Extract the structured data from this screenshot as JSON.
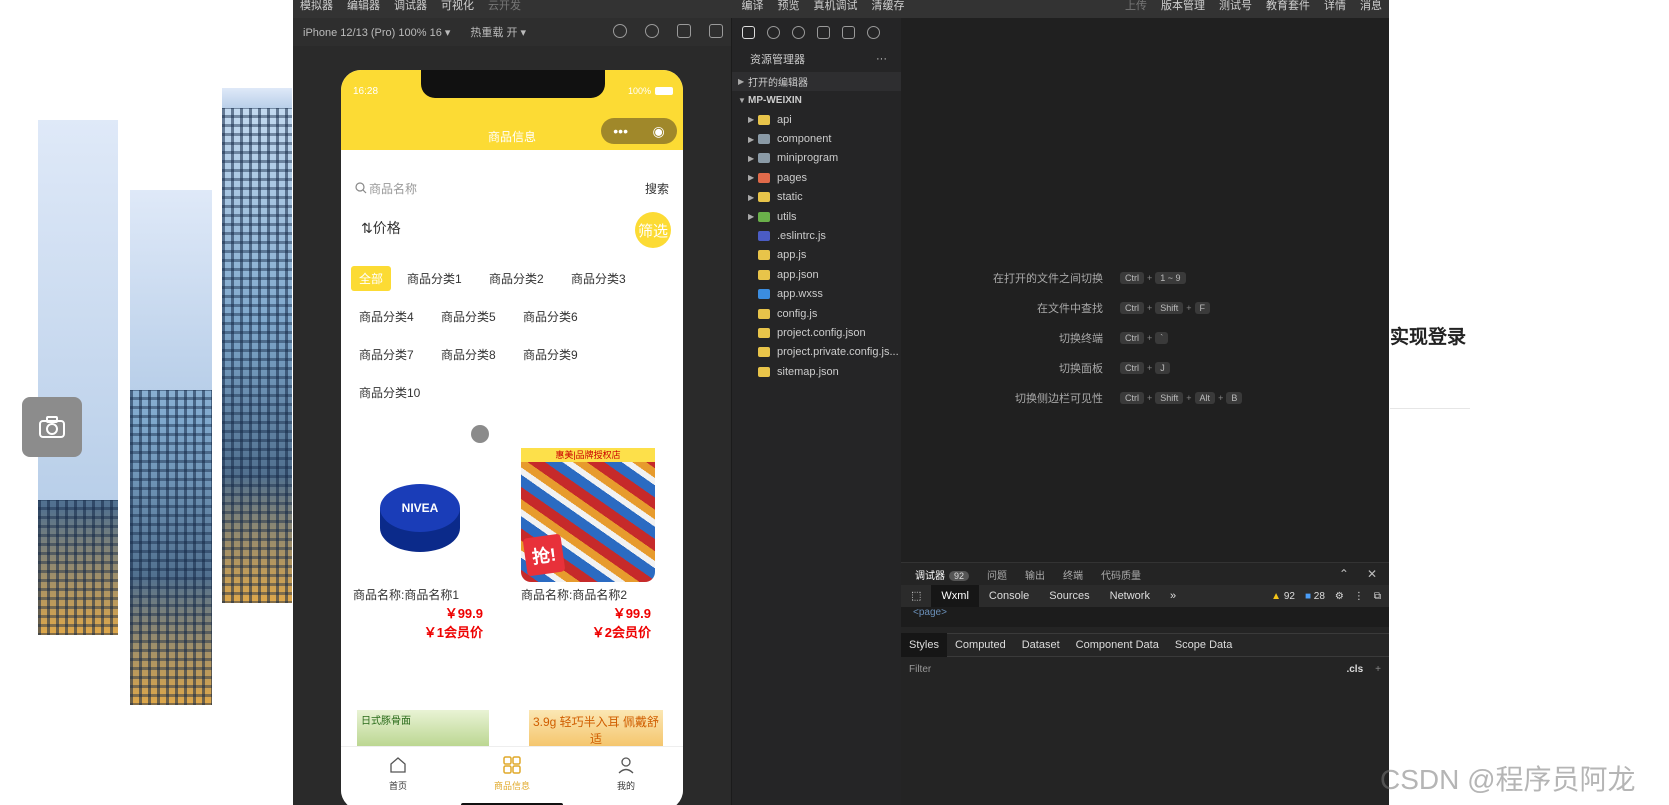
{
  "background": {
    "right_heading": "实现登录",
    "watermark": "CSDN @程序员阿龙"
  },
  "ide": {
    "menu_left": [
      "模拟器",
      "编辑器",
      "调试器",
      "可视化",
      "云开发"
    ],
    "menu_mid": [
      "编译",
      "预览",
      "真机调试",
      "清缓存"
    ],
    "menu_right": [
      "上传",
      "版本管理",
      "测试号",
      "教育套件",
      "详情",
      "消息"
    ],
    "device": "iPhone 12/13 (Pro) 100% 16 ▾",
    "hot_reload": "热重载 开 ▾"
  },
  "phone": {
    "time": "16:28",
    "battery": "100%",
    "nav_title": "商品信息",
    "search_placeholder": "商品名称",
    "search_button": "搜索",
    "sort_label": "⇅价格",
    "filter_button": "筛选",
    "categories": [
      "全部",
      "商品分类1",
      "商品分类2",
      "商品分类3",
      "商品分类4",
      "商品分类5",
      "商品分类6",
      "商品分类7",
      "商品分类8",
      "商品分类9",
      "商品分类10"
    ],
    "products": [
      {
        "name": "商品名称:商品名称1",
        "price": "￥99.9",
        "member_price": "￥1会员价"
      },
      {
        "name": "商品名称:商品名称2",
        "price": "￥99.9",
        "member_price": "￥2会员价"
      }
    ],
    "thumb3_text": "日式豚骨面",
    "thumb4_text": "3.9g 轻巧半入耳 佩戴舒适",
    "candy_banner": "惠美|品牌授权店",
    "candy_tag": "抢!",
    "tabs": [
      {
        "label": "首页",
        "active": false
      },
      {
        "label": "商品信息",
        "active": true
      },
      {
        "label": "我的",
        "active": false
      }
    ]
  },
  "explorer": {
    "title": "资源管理器",
    "more": "···",
    "open_editors": "打开的编辑器",
    "project": "MP-WEIXIN",
    "items": [
      {
        "label": "api",
        "type": "folder",
        "color": "#e8c44a"
      },
      {
        "label": "component",
        "type": "folder",
        "color": "#8a9aa6"
      },
      {
        "label": "miniprogram",
        "type": "folder",
        "color": "#8a9aa6"
      },
      {
        "label": "pages",
        "type": "folder",
        "color": "#e06a4a"
      },
      {
        "label": "static",
        "type": "folder",
        "color": "#e8c44a"
      },
      {
        "label": "utils",
        "type": "folder",
        "color": "#6ab04a"
      },
      {
        "label": ".eslintrc.js",
        "type": "file",
        "color": "#4b5cc4"
      },
      {
        "label": "app.js",
        "type": "file",
        "color": "#e8c44a"
      },
      {
        "label": "app.json",
        "type": "file",
        "color": "#e8c44a"
      },
      {
        "label": "app.wxss",
        "type": "file",
        "color": "#3b8de0"
      },
      {
        "label": "config.js",
        "type": "file",
        "color": "#e8c44a"
      },
      {
        "label": "project.config.json",
        "type": "file",
        "color": "#e8c44a"
      },
      {
        "label": "project.private.config.js...",
        "type": "file",
        "color": "#e8c44a"
      },
      {
        "label": "sitemap.json",
        "type": "file",
        "color": "#e8c44a"
      }
    ]
  },
  "editor": {
    "shortcuts": [
      {
        "label": "在打开的文件之间切换",
        "keys": [
          "Ctrl",
          "1 ~ 9"
        ]
      },
      {
        "label": "在文件中查找",
        "keys": [
          "Ctrl",
          "Shift",
          "F"
        ]
      },
      {
        "label": "切换终端",
        "keys": [
          "Ctrl",
          "`"
        ]
      },
      {
        "label": "切换面板",
        "keys": [
          "Ctrl",
          "J"
        ]
      },
      {
        "label": "切换侧边栏可见性",
        "keys": [
          "Ctrl",
          "Shift",
          "Alt",
          "B"
        ]
      }
    ]
  },
  "debugger": {
    "tabs": [
      "调试器",
      "问题",
      "输出",
      "终端",
      "代码质量"
    ],
    "debug_badge": "92",
    "devtools_tabs": [
      "Wxml",
      "Console",
      "Sources",
      "Network",
      "»"
    ],
    "warnings": "92",
    "infos": "28",
    "page_tag": "<page>",
    "style_tabs": [
      "Styles",
      "Computed",
      "Dataset",
      "Component Data",
      "Scope Data"
    ],
    "filter_placeholder": "Filter",
    "cls_label": ".cls",
    "plus_label": "+"
  }
}
